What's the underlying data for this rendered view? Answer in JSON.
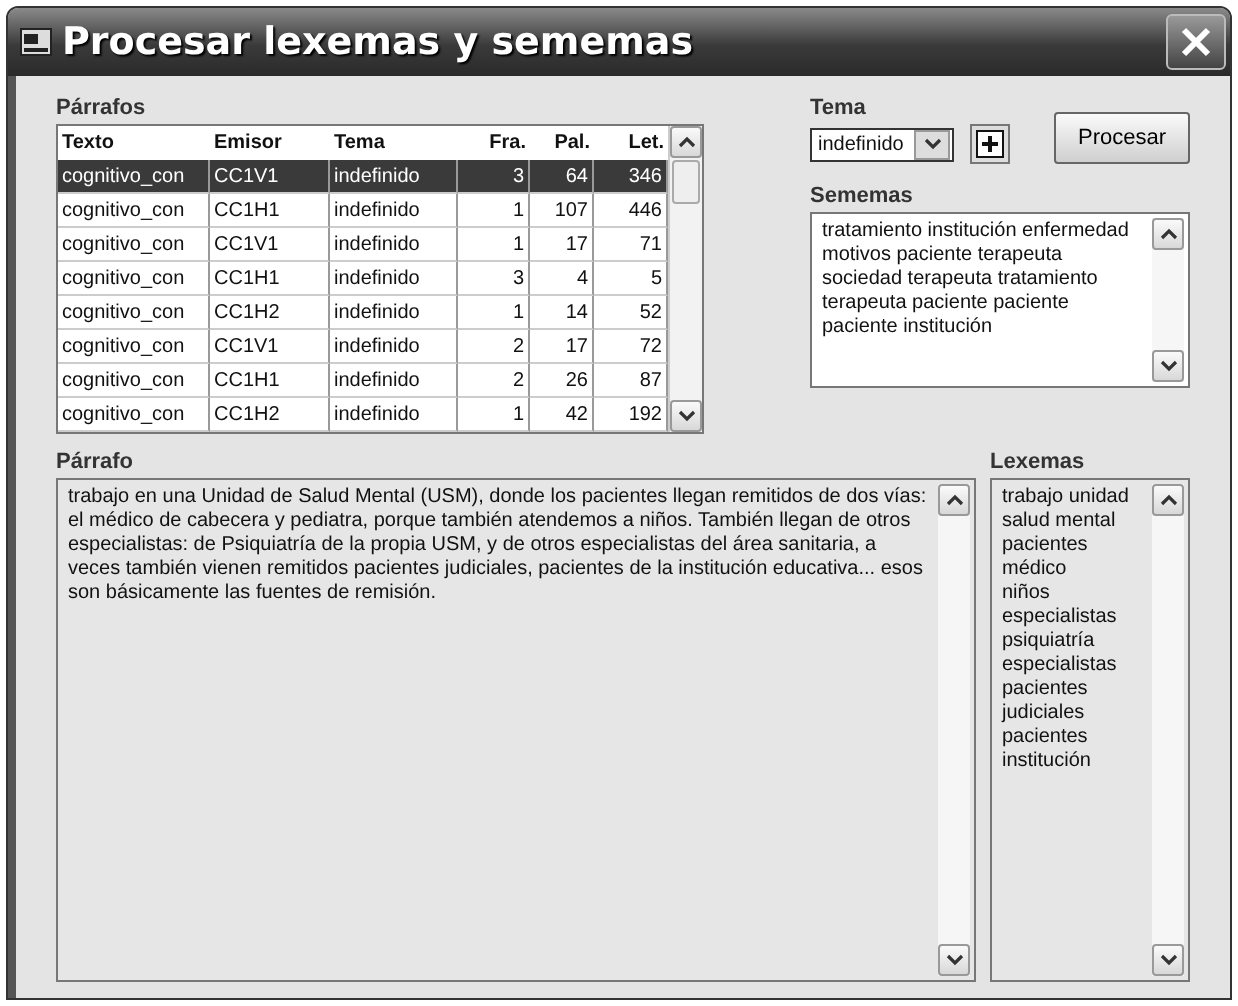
{
  "window": {
    "title": "Procesar lexemas y sememas"
  },
  "parrafos": {
    "label": "Párrafos",
    "columns": [
      "Texto",
      "Emisor",
      "Tema",
      "Fra.",
      "Pal.",
      "Let."
    ],
    "rows": [
      {
        "cells": [
          "cognitivo_con",
          "CC1V1",
          "indefinido",
          "3",
          "64",
          "346"
        ],
        "selected": true
      },
      {
        "cells": [
          "cognitivo_con",
          "CC1H1",
          "indefinido",
          "1",
          "107",
          "446"
        ],
        "selected": false
      },
      {
        "cells": [
          "cognitivo_con",
          "CC1V1",
          "indefinido",
          "1",
          "17",
          "71"
        ],
        "selected": false
      },
      {
        "cells": [
          "cognitivo_con",
          "CC1H1",
          "indefinido",
          "3",
          "4",
          "5"
        ],
        "selected": false
      },
      {
        "cells": [
          "cognitivo_con",
          "CC1H2",
          "indefinido",
          "1",
          "14",
          "52"
        ],
        "selected": false
      },
      {
        "cells": [
          "cognitivo_con",
          "CC1V1",
          "indefinido",
          "2",
          "17",
          "72"
        ],
        "selected": false
      },
      {
        "cells": [
          "cognitivo_con",
          "CC1H1",
          "indefinido",
          "2",
          "26",
          "87"
        ],
        "selected": false
      },
      {
        "cells": [
          "cognitivo_con",
          "CC1H2",
          "indefinido",
          "1",
          "42",
          "192"
        ],
        "selected": false
      }
    ]
  },
  "tema": {
    "label": "Tema",
    "value": "indefinido"
  },
  "buttons": {
    "procesar": "Procesar"
  },
  "sememas": {
    "label": "Sememas",
    "lines": [
      "tratamiento institución enfermedad",
      "motivos paciente terapeuta",
      "sociedad terapeuta tratamiento",
      "terapeuta paciente paciente",
      "paciente institución"
    ]
  },
  "parrafo": {
    "label": "Párrafo",
    "text": "trabajo en una Unidad de Salud Mental (USM), donde los pacientes llegan remitidos de dos vías: el médico de cabecera y pediatra, porque también atendemos a niños. También llegan de otros especialistas: de Psiquiatría de la propia USM, y de otros especialistas del área sanitaria, a veces también vienen remitidos pacientes judiciales, pacientes de la institución educativa... esos son básicamente las fuentes de remisión."
  },
  "lexemas": {
    "label": "Lexemas",
    "lines": [
      "trabajo unidad",
      "salud mental",
      "pacientes médico",
      "niños",
      "especialistas",
      "psiquiatría",
      "especialistas",
      "pacientes",
      "judiciales",
      "pacientes",
      "institución"
    ]
  }
}
